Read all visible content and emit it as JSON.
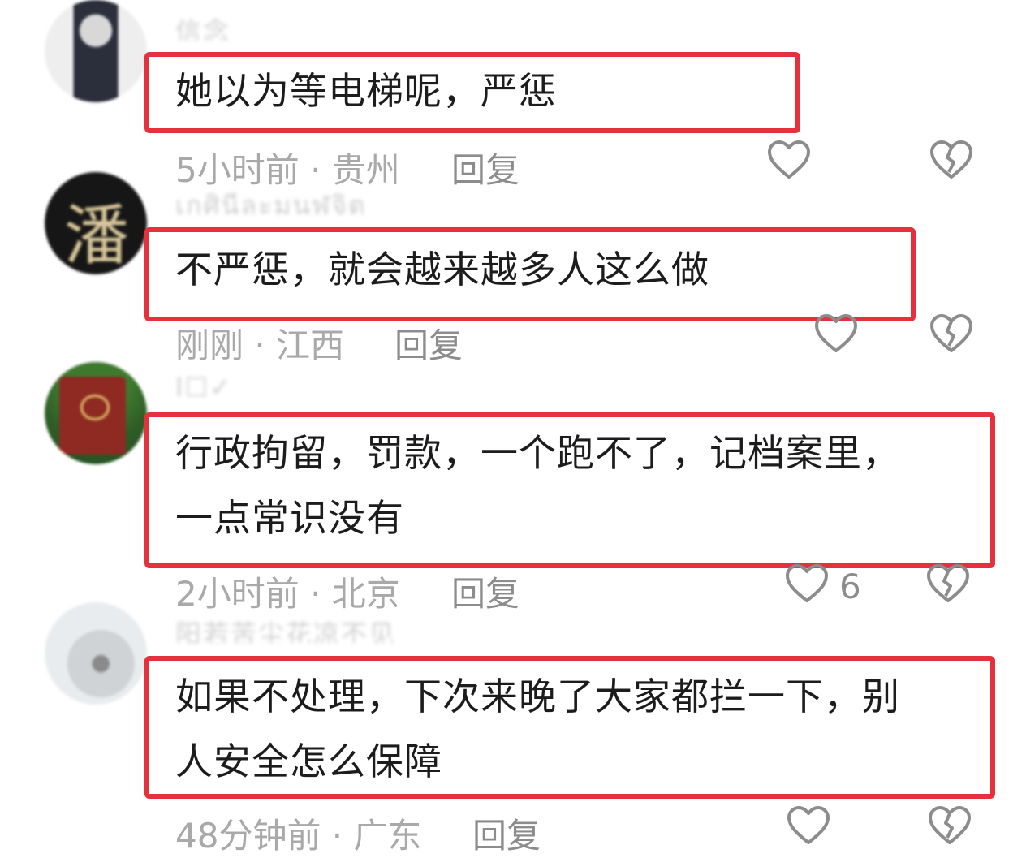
{
  "comments": [
    {
      "username": "信念",
      "text": "她以为等电梯呢，严惩",
      "time_location": "5小时前 · 贵州",
      "reply_label": "回复",
      "like_count": ""
    },
    {
      "username": "เกศินีละมนฬจิต",
      "avatar_char": "潘",
      "text": "不严惩，就会越来越多人这么做",
      "time_location": "刚刚 · 江西",
      "reply_label": "回复",
      "like_count": ""
    },
    {
      "username": "I☐✓",
      "text_lines": [
        "行政拘留，罚款，一个跑不了，记档案里，",
        "一点常识没有"
      ],
      "time_location": "2小时前 · 北京",
      "reply_label": "回复",
      "like_count": "6"
    },
    {
      "username": "阳若苦尘花凉不见",
      "text_lines": [
        "如果不处理，下次来晚了大家都拦一下，别",
        "人安全怎么保障"
      ],
      "time_location": "48分钟前 · 广东",
      "reply_label": "回复",
      "like_count": ""
    }
  ],
  "colors": {
    "highlight_border": "#e5313b",
    "meta_text": "#a9a9a9",
    "icon": "#8c8c8c"
  },
  "icons": [
    "heart-outline-icon",
    "broken-heart-icon"
  ]
}
